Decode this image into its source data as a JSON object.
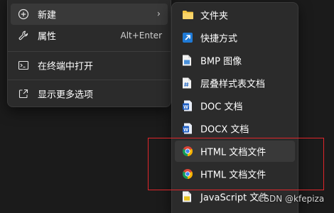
{
  "main_menu": {
    "items": [
      {
        "label": "新建",
        "icon": "plus-circle-icon",
        "has_submenu": true
      },
      {
        "label": "属性",
        "icon": "wrench-icon",
        "shortcut": "Alt+Enter"
      },
      {
        "label": "在终端中打开",
        "icon": "terminal-icon"
      },
      {
        "label": "显示更多选项",
        "icon": "share-out-icon"
      }
    ],
    "submenu_chevron": "›"
  },
  "sub_menu": {
    "items": [
      {
        "label": "文件夹",
        "icon": "folder-icon"
      },
      {
        "label": "快捷方式",
        "icon": "shortcut-arrow-icon"
      },
      {
        "label": "BMP 图像",
        "icon": "bmp-file-icon"
      },
      {
        "label": "层叠样式表文档",
        "icon": "css-file-icon"
      },
      {
        "label": "DOC 文档",
        "icon": "word-doc-icon"
      },
      {
        "label": "DOCX 文档",
        "icon": "word-docx-icon"
      },
      {
        "label": "HTML 文档文件",
        "icon": "chrome-icon"
      },
      {
        "label": "HTML 文档文件",
        "icon": "chrome-icon"
      },
      {
        "label": "JavaScript 文件",
        "icon": "js-file-icon"
      }
    ]
  },
  "watermark": "CSDN @kfepiza",
  "colors": {
    "menu_bg": "#2b2b2b",
    "hover_bg": "#393939",
    "highlight_box": "#e0262b",
    "folder": "#f4c542",
    "word_blue": "#1e5fc4"
  }
}
